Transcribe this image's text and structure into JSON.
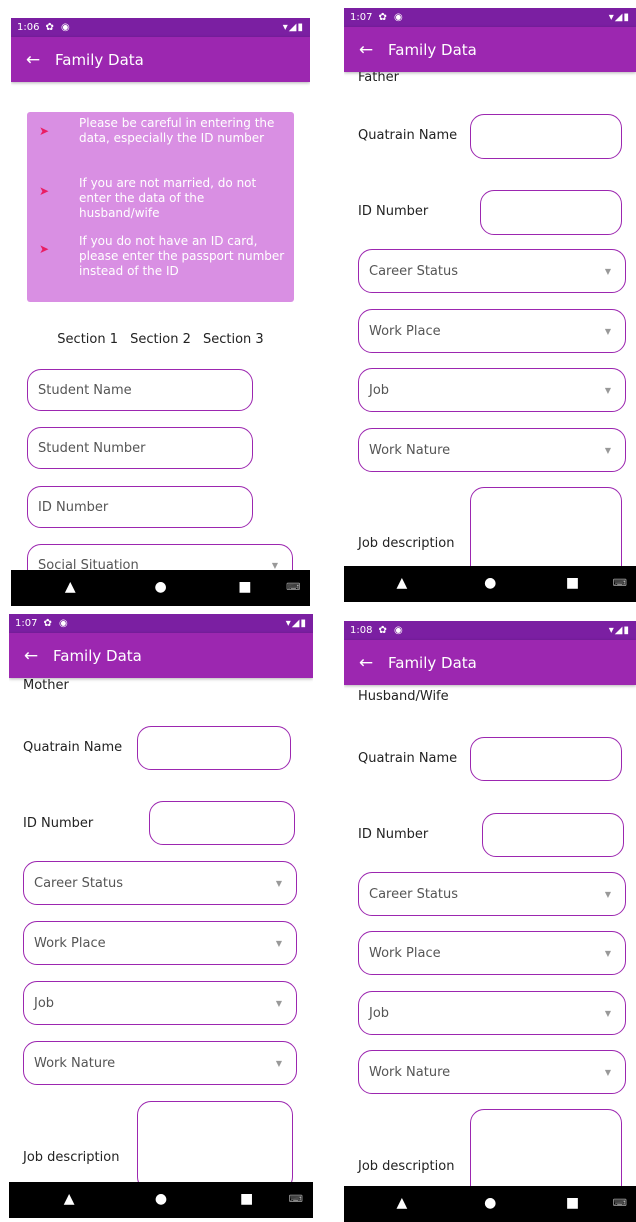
{
  "app": {
    "title": "Family Data"
  },
  "screens": [
    {
      "time": "1:06",
      "notes": [
        "Please be careful in entering the data, especially the ID number",
        "If you are not married, do not enter the data of the husband/wife",
        "If you do not have an ID card, please enter the passport number instead of the ID"
      ],
      "sections": [
        "Section 1",
        "Section 2",
        "Section 3"
      ],
      "fields": [
        "Student Name",
        "Student Number",
        "ID Number",
        "Social Situation"
      ]
    },
    {
      "time": "1:07",
      "heading": "Father",
      "quatrain_label": "Quatrain Name",
      "id_label": "ID Number",
      "dropdowns": [
        "Career Status",
        "Work Place",
        "Job",
        "Work Nature"
      ],
      "job_label": "Job description"
    },
    {
      "time": "1:07",
      "heading": "Mother",
      "quatrain_label": "Quatrain Name",
      "id_label": "ID Number",
      "dropdowns": [
        "Career Status",
        "Work Place",
        "Job",
        "Work Nature"
      ],
      "job_label": "Job description"
    },
    {
      "time": "1:08",
      "heading": "Husband/Wife",
      "quatrain_label": "Quatrain Name",
      "id_label": "ID Number",
      "dropdowns": [
        "Career Status",
        "Work Place",
        "Job",
        "Work Nature"
      ],
      "job_label": "Job description"
    }
  ],
  "icons": {
    "status": "gear-icon, record-icon",
    "status_right": "wifi-icon, signal-icon, battery-icon"
  },
  "colors": {
    "primary": "#9c27b0",
    "status": "#7b1fa2",
    "note_bg": "#d98fe3",
    "bullet": "#e91e63"
  }
}
